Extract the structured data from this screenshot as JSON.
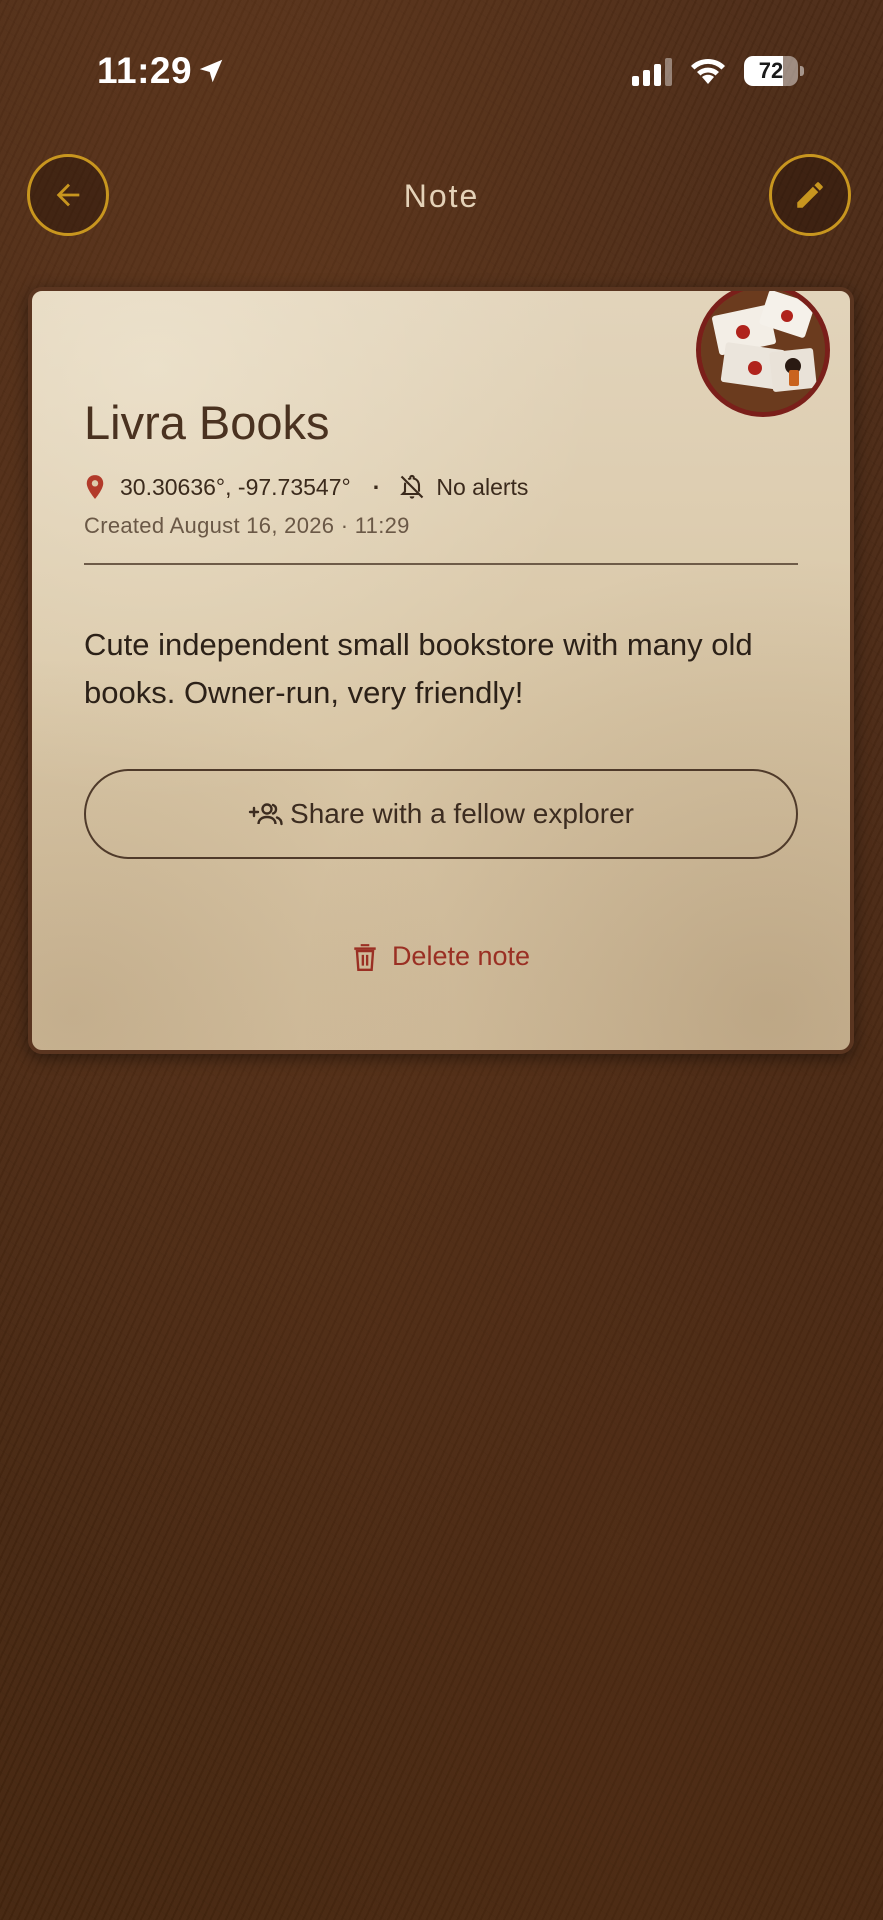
{
  "status_bar": {
    "time": "11:29",
    "battery_level": "72",
    "battery_percent": 72
  },
  "header": {
    "title": "Note",
    "back_icon": "arrow-left-icon",
    "edit_icon": "pencil-icon"
  },
  "note": {
    "title": "Livra Books",
    "coordinates": "30.30636°, -97.73547°",
    "separator": "·",
    "alerts_label": "No alerts",
    "created": "Created August 16, 2026 · 11:29",
    "body": "Cute independent small bookstore with many old books. Owner-run, very friendly!",
    "thumbnail_icon": "envelopes-wax-seal-photo"
  },
  "actions": {
    "share_label": "Share with a fellow explorer",
    "delete_label": "Delete note"
  },
  "colors": {
    "accent_gold": "#c8961f",
    "delete_red": "#9a2f23",
    "pin_red": "#b23a2a",
    "card_paper": "#dccbac"
  }
}
